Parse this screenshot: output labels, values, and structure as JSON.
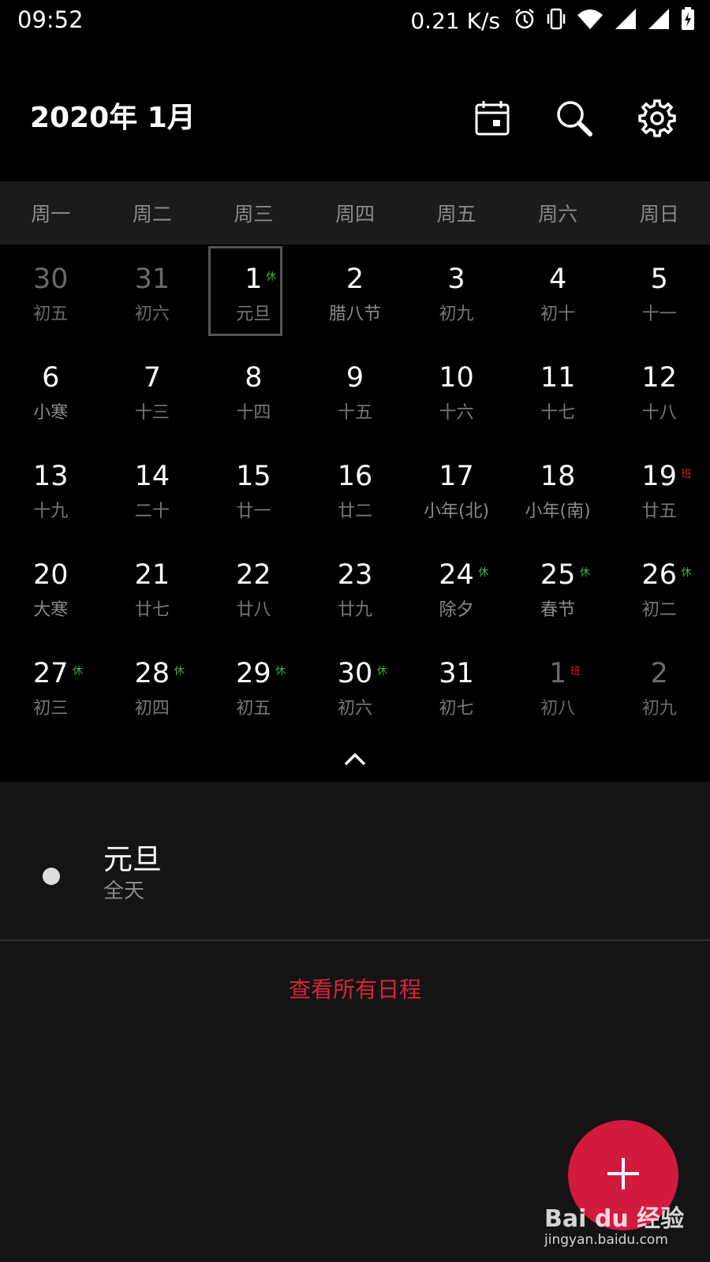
{
  "status_bar": {
    "time": "09:52",
    "net_speed": "0.21 K/s",
    "icons": [
      "alarm-icon",
      "vibrate-icon",
      "wifi-icon",
      "signal-icon",
      "signal-icon-2",
      "battery-charging-icon"
    ]
  },
  "header": {
    "title": "2020年  1月",
    "buttons": [
      "today-calendar-icon",
      "search-icon",
      "settings-gear-icon"
    ]
  },
  "weekdays": [
    "周一",
    "周二",
    "周三",
    "周四",
    "周五",
    "周六",
    "周日"
  ],
  "days": [
    {
      "day": "30",
      "lunar": "初五",
      "badge": "",
      "state": "other"
    },
    {
      "day": "31",
      "lunar": "初六",
      "badge": "",
      "state": "other"
    },
    {
      "day": "1",
      "lunar": "元旦",
      "badge": "休",
      "state": "selected"
    },
    {
      "day": "2",
      "lunar": "腊八节",
      "badge": "",
      "state": "festival"
    },
    {
      "day": "3",
      "lunar": "初九",
      "badge": "",
      "state": ""
    },
    {
      "day": "4",
      "lunar": "初十",
      "badge": "",
      "state": ""
    },
    {
      "day": "5",
      "lunar": "十一",
      "badge": "",
      "state": ""
    },
    {
      "day": "6",
      "lunar": "小寒",
      "badge": "",
      "state": "festival"
    },
    {
      "day": "7",
      "lunar": "十三",
      "badge": "",
      "state": ""
    },
    {
      "day": "8",
      "lunar": "十四",
      "badge": "",
      "state": ""
    },
    {
      "day": "9",
      "lunar": "十五",
      "badge": "",
      "state": ""
    },
    {
      "day": "10",
      "lunar": "十六",
      "badge": "",
      "state": ""
    },
    {
      "day": "11",
      "lunar": "十七",
      "badge": "",
      "state": ""
    },
    {
      "day": "12",
      "lunar": "十八",
      "badge": "",
      "state": ""
    },
    {
      "day": "13",
      "lunar": "十九",
      "badge": "",
      "state": ""
    },
    {
      "day": "14",
      "lunar": "二十",
      "badge": "",
      "state": ""
    },
    {
      "day": "15",
      "lunar": "廿一",
      "badge": "",
      "state": ""
    },
    {
      "day": "16",
      "lunar": "廿二",
      "badge": "",
      "state": ""
    },
    {
      "day": "17",
      "lunar": "小年(北)",
      "badge": "",
      "state": "festival"
    },
    {
      "day": "18",
      "lunar": "小年(南)",
      "badge": "",
      "state": "festival"
    },
    {
      "day": "19",
      "lunar": "廿五",
      "badge": "班",
      "state": ""
    },
    {
      "day": "20",
      "lunar": "大寒",
      "badge": "",
      "state": "festival"
    },
    {
      "day": "21",
      "lunar": "廿七",
      "badge": "",
      "state": ""
    },
    {
      "day": "22",
      "lunar": "廿八",
      "badge": "",
      "state": ""
    },
    {
      "day": "23",
      "lunar": "廿九",
      "badge": "",
      "state": ""
    },
    {
      "day": "24",
      "lunar": "除夕",
      "badge": "休",
      "state": "festival"
    },
    {
      "day": "25",
      "lunar": "春节",
      "badge": "休",
      "state": "festival"
    },
    {
      "day": "26",
      "lunar": "初二",
      "badge": "休",
      "state": ""
    },
    {
      "day": "27",
      "lunar": "初三",
      "badge": "休",
      "state": ""
    },
    {
      "day": "28",
      "lunar": "初四",
      "badge": "休",
      "state": ""
    },
    {
      "day": "29",
      "lunar": "初五",
      "badge": "休",
      "state": ""
    },
    {
      "day": "30",
      "lunar": "初六",
      "badge": "休",
      "state": ""
    },
    {
      "day": "31",
      "lunar": "初七",
      "badge": "",
      "state": ""
    },
    {
      "day": "1",
      "lunar": "初八",
      "badge": "班",
      "state": "other"
    },
    {
      "day": "2",
      "lunar": "初九",
      "badge": "",
      "state": "other"
    }
  ],
  "events": [
    {
      "title": "元旦",
      "subtitle": "全天",
      "dot_color": "#dddddd"
    }
  ],
  "view_all_label": "查看所有日程",
  "fab_icon": "plus-icon",
  "watermark": {
    "brand": "Bai du 经验",
    "url": "jingyan.baidu.com"
  },
  "colors": {
    "accent": "#d11a3e",
    "rest_badge": "#39b04c",
    "work_badge": "#d21f2b"
  }
}
